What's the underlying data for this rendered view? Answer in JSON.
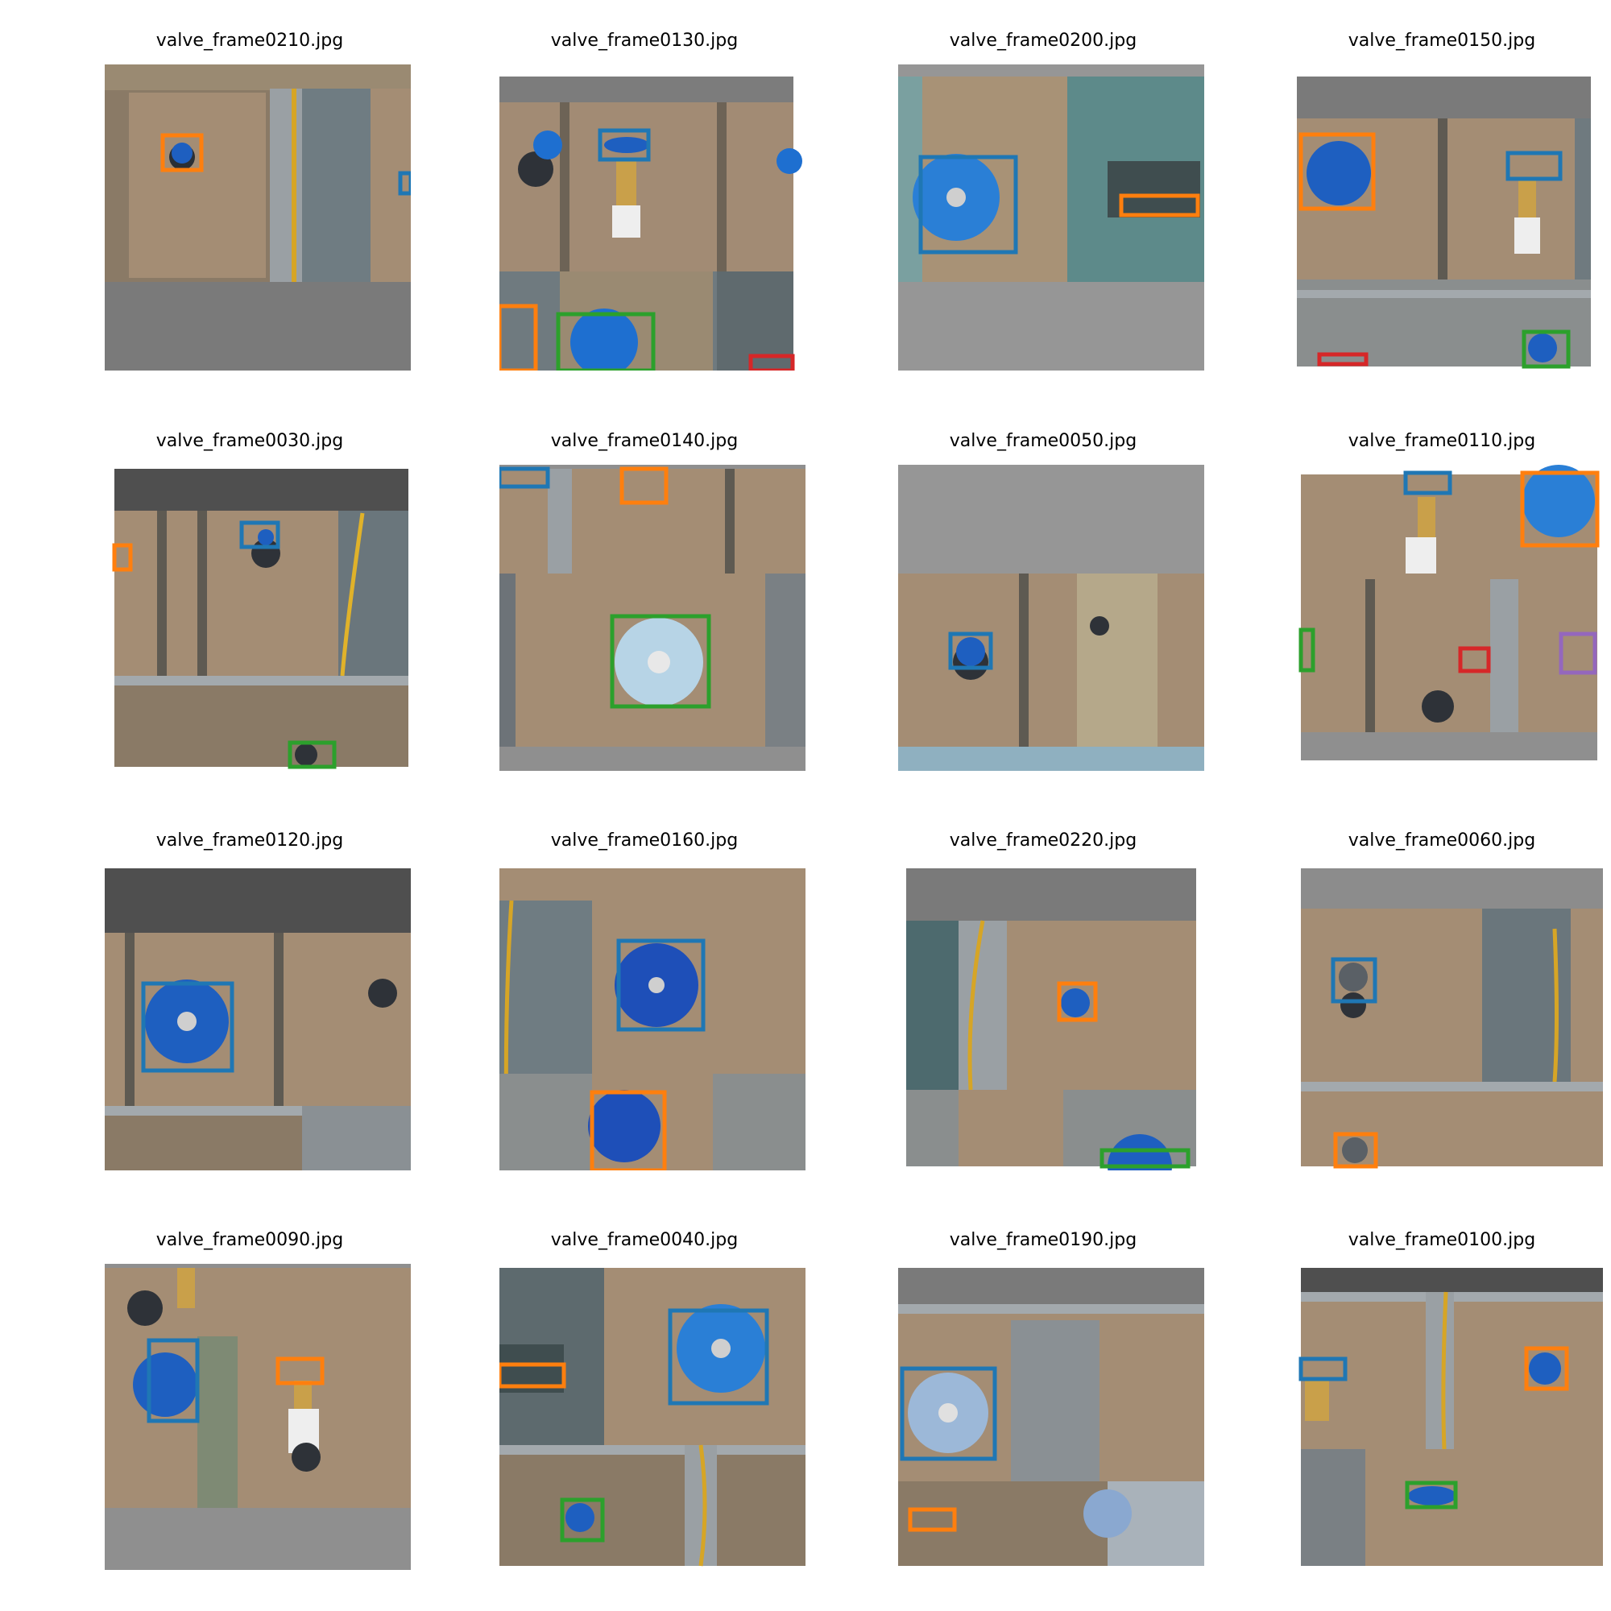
{
  "window": {
    "title": ""
  },
  "colors": {
    "box_colors": [
      "#1f77b4",
      "#ff7f0e",
      "#2ca02c",
      "#d62728",
      "#9467bd"
    ],
    "pad_gray": "#8c8c8c",
    "board": "#a08a72",
    "frame_rail": "#9aa0a4",
    "valve_blue": "#1e6fd0"
  },
  "grid": {
    "rows": 4,
    "cols": 4,
    "images": [
      {
        "label": "valve_frame0210.jpg",
        "box_count": 2,
        "boxes": [
          "#1f77b4/#ff7f0e",
          "#1f77b4"
        ]
      },
      {
        "label": "valve_frame0130.jpg",
        "box_count": 4,
        "boxes": [
          "#1f77b4",
          "#ff7f0e",
          "#2ca02c",
          "#d62728"
        ]
      },
      {
        "label": "valve_frame0200.jpg",
        "box_count": 2,
        "boxes": [
          "#1f77b4",
          "#ff7f0e"
        ]
      },
      {
        "label": "valve_frame0150.jpg",
        "box_count": 4,
        "boxes": [
          "#ff7f0e",
          "#1f77b4",
          "#d62728",
          "#2ca02c"
        ]
      },
      {
        "label": "valve_frame0030.jpg",
        "box_count": 3,
        "boxes": [
          "#1f77b4",
          "#ff7f0e",
          "#2ca02c"
        ]
      },
      {
        "label": "valve_frame0140.jpg",
        "box_count": 3,
        "boxes": [
          "#1f77b4",
          "#ff7f0e",
          "#2ca02c"
        ]
      },
      {
        "label": "valve_frame0050.jpg",
        "box_count": 1,
        "boxes": [
          "#1f77b4"
        ]
      },
      {
        "label": "valve_frame0110.jpg",
        "box_count": 5,
        "boxes": [
          "#1f77b4",
          "#ff7f0e",
          "#2ca02c",
          "#d62728",
          "#9467bd"
        ]
      },
      {
        "label": "valve_frame0120.jpg",
        "box_count": 1,
        "boxes": [
          "#1f77b4"
        ]
      },
      {
        "label": "valve_frame0160.jpg",
        "box_count": 2,
        "boxes": [
          "#1f77b4",
          "#ff7f0e"
        ]
      },
      {
        "label": "valve_frame0220.jpg",
        "box_count": 2,
        "boxes": [
          "#ff7f0e",
          "#2ca02c"
        ]
      },
      {
        "label": "valve_frame0060.jpg",
        "box_count": 2,
        "boxes": [
          "#1f77b4",
          "#ff7f0e"
        ]
      },
      {
        "label": "valve_frame0090.jpg",
        "box_count": 2,
        "boxes": [
          "#1f77b4",
          "#ff7f0e"
        ]
      },
      {
        "label": "valve_frame0040.jpg",
        "box_count": 3,
        "boxes": [
          "#1f77b4",
          "#ff7f0e",
          "#2ca02c"
        ]
      },
      {
        "label": "valve_frame0190.jpg",
        "box_count": 2,
        "boxes": [
          "#1f77b4",
          "#ff7f0e"
        ]
      },
      {
        "label": "valve_frame0100.jpg",
        "box_count": 3,
        "boxes": [
          "#ff7f0e",
          "#1f77b4",
          "#2ca02c"
        ]
      }
    ]
  }
}
